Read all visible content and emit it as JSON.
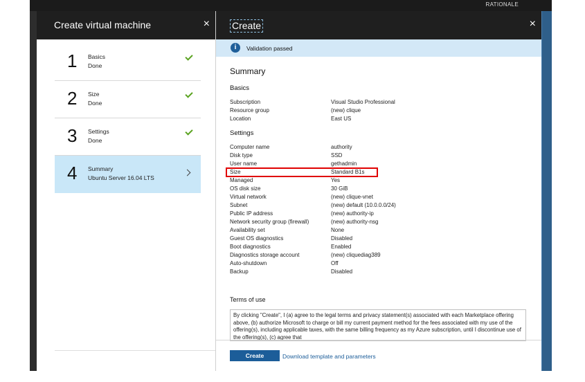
{
  "corner_text": "RATIONALE",
  "left_blade": {
    "title": "Create virtual machine",
    "close": "×",
    "steps": [
      {
        "num": "1",
        "label": "Basics",
        "sub": "Done"
      },
      {
        "num": "2",
        "label": "Size",
        "sub": "Done"
      },
      {
        "num": "3",
        "label": "Settings",
        "sub": "Done"
      },
      {
        "num": "4",
        "label": "Summary",
        "sub": "Ubuntu Server 16.04 LTS"
      }
    ]
  },
  "right_blade": {
    "title": "Create",
    "close": "×",
    "banner": {
      "icon": "i",
      "text": "Validation passed"
    },
    "summary_title": "Summary",
    "basics_title": "Basics",
    "basics": [
      {
        "k": "Subscription",
        "v": "Visual Studio Professional"
      },
      {
        "k": "Resource group",
        "v": "(new) clique"
      },
      {
        "k": "Location",
        "v": "East US"
      }
    ],
    "settings_title": "Settings",
    "settings": [
      {
        "k": "Computer name",
        "v": "authority"
      },
      {
        "k": "Disk type",
        "v": "SSD"
      },
      {
        "k": "User name",
        "v": "gethadmin"
      },
      {
        "k": "Size",
        "v": "Standard B1s"
      },
      {
        "k": "Managed",
        "v": "Yes"
      },
      {
        "k": "OS disk size",
        "v": "30 GiB"
      },
      {
        "k": "Virtual network",
        "v": "(new) clique-vnet"
      },
      {
        "k": "Subnet",
        "v": "(new) default (10.0.0.0/24)"
      },
      {
        "k": "Public IP address",
        "v": "(new) authority-ip"
      },
      {
        "k": "Network security group (firewall)",
        "v": "(new) authority-nsg"
      },
      {
        "k": "Availability set",
        "v": "None"
      },
      {
        "k": "Guest OS diagnostics",
        "v": "Disabled"
      },
      {
        "k": "Boot diagnostics",
        "v": "Enabled"
      },
      {
        "k": "Diagnostics storage account",
        "v": "(new) cliquediag389"
      },
      {
        "k": "Auto-shutdown",
        "v": "Off"
      },
      {
        "k": "Backup",
        "v": "Disabled"
      }
    ],
    "terms_title": "Terms of use",
    "terms_text": "By clicking \"Create\", I (a) agree to the legal terms and privacy statement(s) associated with each Marketplace offering above, (b) authorize Microsoft to charge or bill my current payment method for the fees associated with my use of the offering(s), including applicable taxes, with the same billing frequency as my Azure subscription, until I discontinue use of the offering(s), (c) agree that",
    "create_button": "Create",
    "download_link": "Download template and parameters"
  },
  "colors": {
    "accent": "#1c5d99",
    "banner": "#d3e8f7",
    "active_step": "#c9e7f8",
    "check": "#5ba321",
    "highlight": "#e00000"
  }
}
